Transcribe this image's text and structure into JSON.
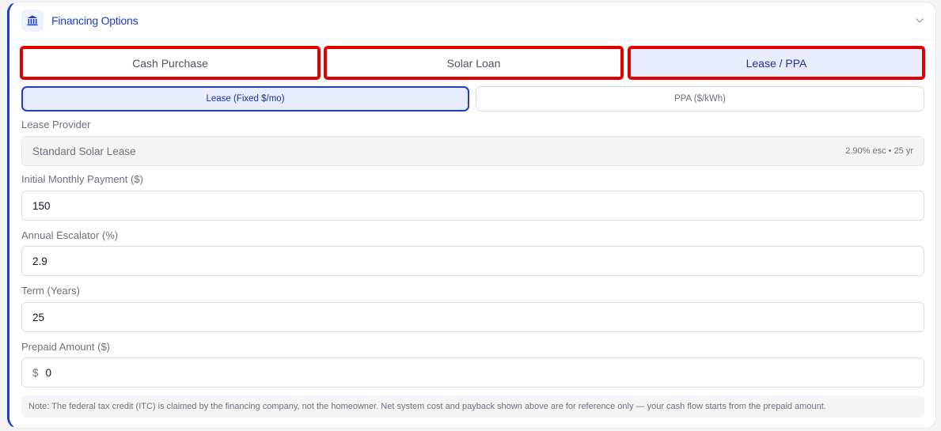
{
  "section": {
    "title": "Financing Options",
    "icon": "bank-icon",
    "accent_color": "#1d3bd8",
    "highlight_color": "#e00000"
  },
  "tabs": [
    {
      "label": "Cash Purchase",
      "active": false
    },
    {
      "label": "Solar Loan",
      "active": false
    },
    {
      "label": "Lease / PPA",
      "active": true
    }
  ],
  "subtabs": [
    {
      "label": "Lease (Fixed $/mo)",
      "active": true
    },
    {
      "label": "PPA ($/kWh)",
      "active": false
    }
  ],
  "fields": {
    "provider": {
      "label": "Lease Provider",
      "value": "Standard Solar Lease",
      "meta": "2.90% esc • 25 yr"
    },
    "monthly_payment": {
      "label": "Initial Monthly Payment ($)",
      "value": "150"
    },
    "escalator": {
      "label": "Annual Escalator (%)",
      "value": "2.9"
    },
    "term": {
      "label": "Term (Years)",
      "value": "25"
    },
    "prepaid": {
      "label": "Prepaid Amount ($)",
      "prefix": "$",
      "value": "0"
    }
  },
  "note": "Note: The federal tax credit (ITC) is claimed by the financing company, not the homeowner. Net system cost and payback shown above are for reference only — your cash flow starts from the prepaid amount."
}
